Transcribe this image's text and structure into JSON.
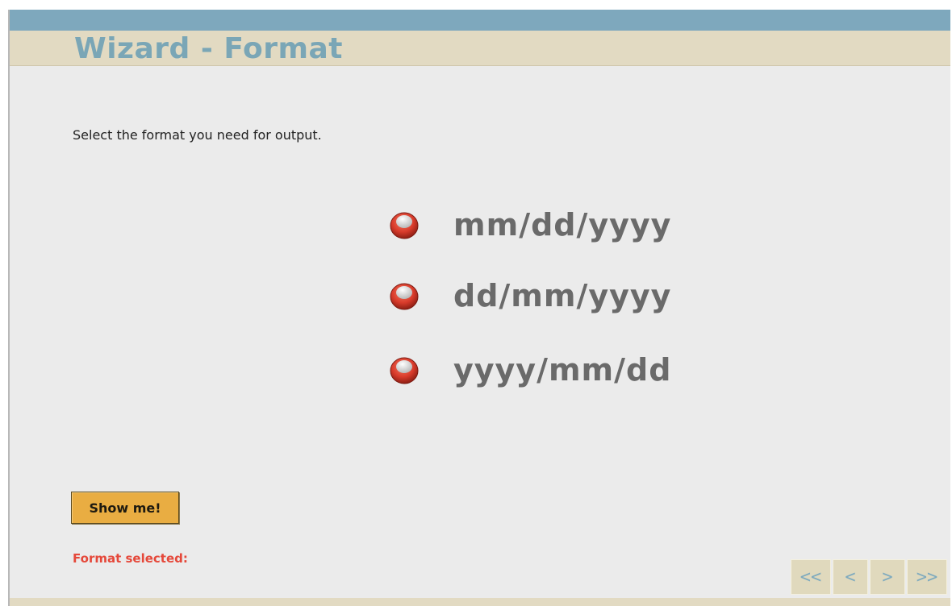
{
  "window": {
    "title": "Wizard - Format"
  },
  "main": {
    "instruction": "Select the format you need for output.",
    "options": [
      {
        "label": "mm/dd/yyyy",
        "selected": false
      },
      {
        "label": "dd/mm/yyyy",
        "selected": false
      },
      {
        "label": "yyyy/mm/dd",
        "selected": false
      }
    ],
    "show_button_label": "Show me!",
    "format_selected_label": "Format selected:"
  },
  "nav": {
    "first": "<<",
    "prev": "<",
    "next": ">",
    "last": ">>"
  },
  "colors": {
    "accent_blue": "#7aa6b6",
    "title_bar": "#e2dac2",
    "button_orange": "#e9ad42",
    "radio_red": "#d93b2b",
    "selected_text_red": "#e5483a"
  },
  "icons": {
    "radio": "radio-button-icon"
  }
}
